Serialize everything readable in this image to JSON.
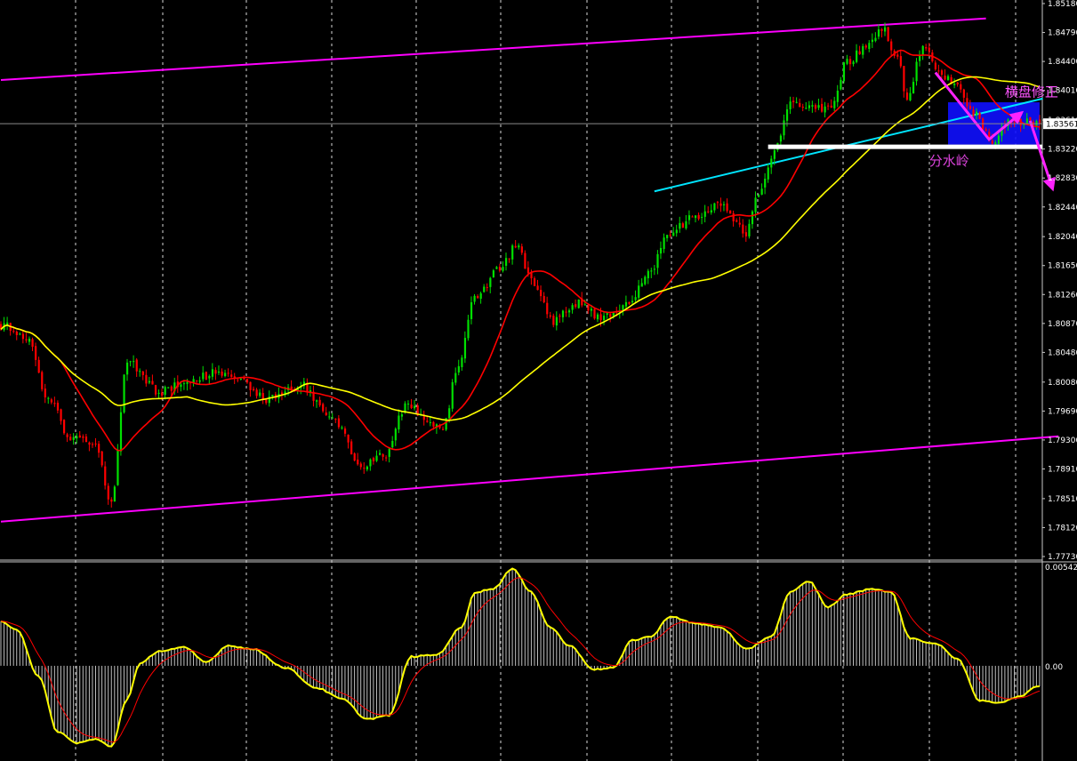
{
  "chart_data": [
    {
      "type": "candlestick",
      "panel": "price",
      "ylim": [
        1.7773,
        1.8518
      ],
      "price_axis_ticks": [
        "1.85180",
        "1.84790",
        "1.84400",
        "1.84010",
        "1.83610",
        "1.83220",
        "1.82830",
        "1.82440",
        "1.82040",
        "1.81650",
        "1.81260",
        "1.80870",
        "1.80480",
        "1.80080",
        "1.79690",
        "1.79300",
        "1.78910",
        "1.78510",
        "1.78120",
        "1.77730"
      ],
      "current_price_label": "1.83561",
      "current_price": 1.83561,
      "candles_count": 330,
      "bull_color": "#00e000",
      "bear_color": "#ff0000",
      "path_anchors": [
        {
          "i": 0,
          "p": 1.8085
        },
        {
          "i": 8,
          "p": 1.807
        },
        {
          "i": 15,
          "p": 1.7985
        },
        {
          "i": 22,
          "p": 1.7935
        },
        {
          "i": 30,
          "p": 1.7925
        },
        {
          "i": 35,
          "p": 1.7845
        },
        {
          "i": 40,
          "p": 1.8035
        },
        {
          "i": 50,
          "p": 1.7995
        },
        {
          "i": 60,
          "p": 1.801
        },
        {
          "i": 68,
          "p": 1.802
        },
        {
          "i": 75,
          "p": 1.801
        },
        {
          "i": 85,
          "p": 1.7985
        },
        {
          "i": 95,
          "p": 1.8005
        },
        {
          "i": 105,
          "p": 1.7955
        },
        {
          "i": 115,
          "p": 1.7895
        },
        {
          "i": 122,
          "p": 1.791
        },
        {
          "i": 128,
          "p": 1.7975
        },
        {
          "i": 140,
          "p": 1.7945
        },
        {
          "i": 145,
          "p": 1.8035
        },
        {
          "i": 150,
          "p": 1.812
        },
        {
          "i": 158,
          "p": 1.816
        },
        {
          "i": 163,
          "p": 1.819
        },
        {
          "i": 170,
          "p": 1.813
        },
        {
          "i": 175,
          "p": 1.809
        },
        {
          "i": 182,
          "p": 1.8115
        },
        {
          "i": 190,
          "p": 1.8095
        },
        {
          "i": 198,
          "p": 1.811
        },
        {
          "i": 205,
          "p": 1.8155
        },
        {
          "i": 212,
          "p": 1.821
        },
        {
          "i": 220,
          "p": 1.823
        },
        {
          "i": 228,
          "p": 1.825
        },
        {
          "i": 236,
          "p": 1.821
        },
        {
          "i": 240,
          "p": 1.8265
        },
        {
          "i": 245,
          "p": 1.832
        },
        {
          "i": 250,
          "p": 1.8385
        },
        {
          "i": 258,
          "p": 1.8375
        },
        {
          "i": 263,
          "p": 1.838
        },
        {
          "i": 268,
          "p": 1.844
        },
        {
          "i": 273,
          "p": 1.8455
        },
        {
          "i": 279,
          "p": 1.8485
        },
        {
          "i": 284,
          "p": 1.8445
        },
        {
          "i": 287,
          "p": 1.839
        },
        {
          "i": 292,
          "p": 1.846
        },
        {
          "i": 298,
          "p": 1.842
        },
        {
          "i": 303,
          "p": 1.841
        },
        {
          "i": 308,
          "p": 1.837
        },
        {
          "i": 314,
          "p": 1.8335
        },
        {
          "i": 320,
          "p": 1.836
        },
        {
          "i": 329,
          "p": 1.8356
        }
      ],
      "moving_averages": [
        {
          "color": "#ff0000",
          "period": 20
        },
        {
          "color": "#ffff00",
          "period": 60
        }
      ],
      "annotations": [
        {
          "kind": "channel-line",
          "color": "#ff00ff",
          "from": {
            "i": 0,
            "p": 1.8415
          },
          "to": {
            "i": 312,
            "p": 1.8498
          }
        },
        {
          "kind": "channel-line",
          "color": "#ff00ff",
          "from": {
            "i": 0,
            "p": 1.782
          },
          "to": {
            "i": 335,
            "p": 1.7935
          }
        },
        {
          "kind": "trend-line",
          "color": "#00e5ff",
          "from": {
            "i": 207,
            "p": 1.8265
          },
          "to": {
            "i": 330,
            "p": 1.839
          }
        },
        {
          "kind": "horizontal-level",
          "color": "#ffffff",
          "from": {
            "i": 243,
            "p": 1.8325
          },
          "to": {
            "i": 335,
            "p": 1.8325
          }
        },
        {
          "kind": "zone",
          "color": "#1010ff",
          "from": {
            "i": 300,
            "p": 1.8385
          },
          "to": {
            "i": 329,
            "p": 1.8328
          }
        },
        {
          "kind": "arrow-path",
          "color": "#ff22ff",
          "points": [
            {
              "i": 296,
              "p": 1.8425
            },
            {
              "i": 313,
              "p": 1.8335
            },
            {
              "i": 323,
              "p": 1.837
            }
          ]
        },
        {
          "kind": "arrow-path",
          "color": "#ff22ff",
          "points": [
            {
              "i": 326,
              "p": 1.836
            },
            {
              "i": 333,
              "p": 1.827
            }
          ]
        }
      ],
      "labels": [
        {
          "text": "横盘修正",
          "color": "#ff55ff",
          "at": {
            "i": 318,
            "p": 1.8393
          }
        },
        {
          "text": "分水岭",
          "color": "#dd44dd",
          "at": {
            "i": 294,
            "p": 1.83
          }
        }
      ]
    },
    {
      "type": "macd",
      "panel": "indicator",
      "ylim": [
        -0.0047,
        0.00542
      ],
      "axis_ticks": [
        "0.00542",
        "0.00"
      ],
      "histogram_color": "#c0c0c0",
      "main_line_color": "#ffff00",
      "signal_line_color": "#ff0000",
      "histogram_anchors": [
        {
          "i": 0,
          "v": 0.0024
        },
        {
          "i": 5,
          "v": 0.002
        },
        {
          "i": 12,
          "v": -0.0006
        },
        {
          "i": 18,
          "v": -0.0036
        },
        {
          "i": 24,
          "v": -0.0042
        },
        {
          "i": 30,
          "v": -0.004
        },
        {
          "i": 35,
          "v": -0.0044
        },
        {
          "i": 40,
          "v": -0.0018
        },
        {
          "i": 44,
          "v": 0.0001
        },
        {
          "i": 50,
          "v": 0.0008
        },
        {
          "i": 58,
          "v": 0.001
        },
        {
          "i": 65,
          "v": 0.0002
        },
        {
          "i": 72,
          "v": 0.0011
        },
        {
          "i": 80,
          "v": 0.0009
        },
        {
          "i": 90,
          "v": -0.0001
        },
        {
          "i": 100,
          "v": -0.0012
        },
        {
          "i": 108,
          "v": -0.0018
        },
        {
          "i": 116,
          "v": -0.0029
        },
        {
          "i": 123,
          "v": -0.0027
        },
        {
          "i": 130,
          "v": 0.0005
        },
        {
          "i": 138,
          "v": 0.0006
        },
        {
          "i": 146,
          "v": 0.0021
        },
        {
          "i": 150,
          "v": 0.004
        },
        {
          "i": 156,
          "v": 0.0042
        },
        {
          "i": 162,
          "v": 0.0053
        },
        {
          "i": 168,
          "v": 0.004
        },
        {
          "i": 174,
          "v": 0.0021
        },
        {
          "i": 180,
          "v": 0.0011
        },
        {
          "i": 188,
          "v": -0.0002
        },
        {
          "i": 194,
          "v": -0.0001
        },
        {
          "i": 200,
          "v": 0.0014
        },
        {
          "i": 206,
          "v": 0.0016
        },
        {
          "i": 212,
          "v": 0.0027
        },
        {
          "i": 220,
          "v": 0.0023
        },
        {
          "i": 228,
          "v": 0.0021
        },
        {
          "i": 236,
          "v": 0.0009
        },
        {
          "i": 244,
          "v": 0.0016
        },
        {
          "i": 250,
          "v": 0.004
        },
        {
          "i": 256,
          "v": 0.0046
        },
        {
          "i": 262,
          "v": 0.0032
        },
        {
          "i": 268,
          "v": 0.0039
        },
        {
          "i": 276,
          "v": 0.0042
        },
        {
          "i": 282,
          "v": 0.004
        },
        {
          "i": 288,
          "v": 0.0015
        },
        {
          "i": 296,
          "v": 0.0012
        },
        {
          "i": 303,
          "v": 0.0004
        },
        {
          "i": 310,
          "v": -0.0019
        },
        {
          "i": 316,
          "v": -0.002
        },
        {
          "i": 322,
          "v": -0.0017
        },
        {
          "i": 329,
          "v": -0.0011
        }
      ]
    }
  ]
}
